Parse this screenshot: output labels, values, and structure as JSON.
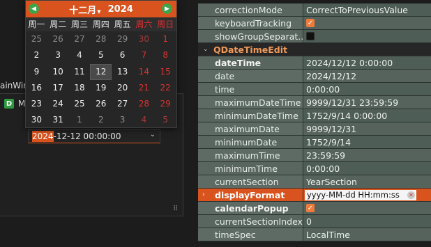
{
  "main_window": {
    "title_fragment": "ainWin",
    "tree_item_icon_letter": "D",
    "tree_item_label": "M",
    "datetime_edit": {
      "selected_section": "2024",
      "rest": "-12-12 00:00:00"
    }
  },
  "calendar": {
    "month": "十二月",
    "year": "2024",
    "weekday_headers": [
      "周一",
      "周二",
      "周三",
      "周四",
      "周五",
      "周六",
      "周日"
    ],
    "weeks": [
      [
        "25",
        "26",
        "27",
        "28",
        "29",
        "30",
        "1"
      ],
      [
        "2",
        "3",
        "4",
        "5",
        "6",
        "7",
        "8"
      ],
      [
        "9",
        "10",
        "11",
        "12",
        "13",
        "14",
        "15"
      ],
      [
        "16",
        "17",
        "18",
        "19",
        "20",
        "21",
        "22"
      ],
      [
        "23",
        "24",
        "25",
        "26",
        "27",
        "28",
        "29"
      ],
      [
        "30",
        "31",
        "1",
        "2",
        "3",
        "4",
        "5"
      ]
    ],
    "selected_day": "12",
    "colors": {
      "header_bg": "#d9531e",
      "weekend": "#e03030",
      "nav_button": "#3fa34a"
    }
  },
  "properties": {
    "rows": [
      {
        "name": "correctionMode",
        "value": "CorrectToPreviousValue"
      },
      {
        "name": "keyboardTracking",
        "checkbox": true
      },
      {
        "name": "showGroupSeparat...",
        "checkbox": false
      },
      {
        "group": "QDateTimeEdit"
      },
      {
        "name": "dateTime",
        "value": "2024/12/12 0:00:00",
        "bold": true
      },
      {
        "name": "date",
        "value": "2024/12/12"
      },
      {
        "name": "time",
        "value": "0:00:00"
      },
      {
        "name": "maximumDateTime",
        "value": "9999/12/31 23:59:59"
      },
      {
        "name": "minimumDateTime",
        "value": "1752/9/14 0:00:00"
      },
      {
        "name": "maximumDate",
        "value": "9999/12/31"
      },
      {
        "name": "minimumDate",
        "value": "1752/9/14"
      },
      {
        "name": "maximumTime",
        "value": "23:59:59"
      },
      {
        "name": "minimumTime",
        "value": "0:00:00"
      },
      {
        "name": "currentSection",
        "value": "YearSection"
      },
      {
        "name": "displayFormat",
        "value": "yyyy-MM-dd HH:mm:ss",
        "highlight": true,
        "editing": true
      },
      {
        "name": "calendarPopup",
        "checkbox": true,
        "bold": true
      },
      {
        "name": "currentSectionIndex",
        "value": "0"
      },
      {
        "name": "timeSpec",
        "value": "LocalTime"
      }
    ],
    "accent_color": "#d9531e",
    "group_label_color": "#f09a5a"
  }
}
